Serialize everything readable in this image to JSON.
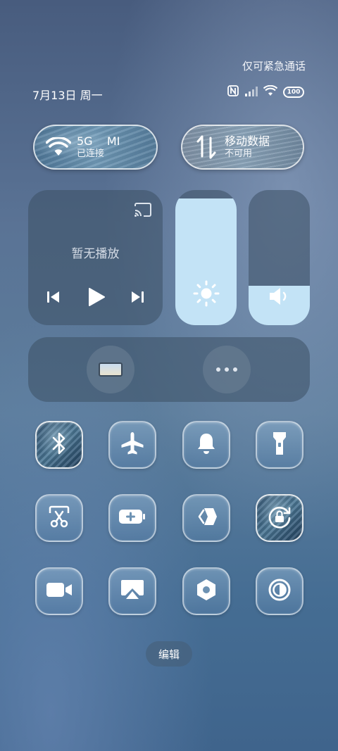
{
  "status_bar": {
    "emergency_text": "仅可紧急通话",
    "date": "7月13日 周一",
    "battery_level": "100"
  },
  "wifi_toggle": {
    "title": "5G",
    "network_name_partial": "MI",
    "subtitle": "已连接",
    "active": true
  },
  "mobile_data_toggle": {
    "title": "移动数据",
    "subtitle": "不可用",
    "active": false
  },
  "media": {
    "title": "暂无播放"
  },
  "brightness": {
    "level_percent": 94
  },
  "volume": {
    "level_percent": 29
  },
  "quick_tiles": [
    {
      "icon": "bluetooth-icon",
      "active": true
    },
    {
      "icon": "airplane-icon",
      "active": false
    },
    {
      "icon": "bell-icon",
      "active": false
    },
    {
      "icon": "flashlight-icon",
      "active": false
    },
    {
      "icon": "screenshot-icon",
      "active": false
    },
    {
      "icon": "battery-saver-icon",
      "active": false
    },
    {
      "icon": "share-icon",
      "active": false
    },
    {
      "icon": "rotation-lock-icon",
      "active": true
    },
    {
      "icon": "video-icon",
      "active": false
    },
    {
      "icon": "cast-screen-icon",
      "active": false
    },
    {
      "icon": "settings-hex-icon",
      "active": false
    },
    {
      "icon": "dark-mode-icon",
      "active": false
    }
  ],
  "edit_label": "编辑",
  "colors": {
    "slider_fill": "#c3e3f6",
    "card_bg": "#3c5064"
  }
}
